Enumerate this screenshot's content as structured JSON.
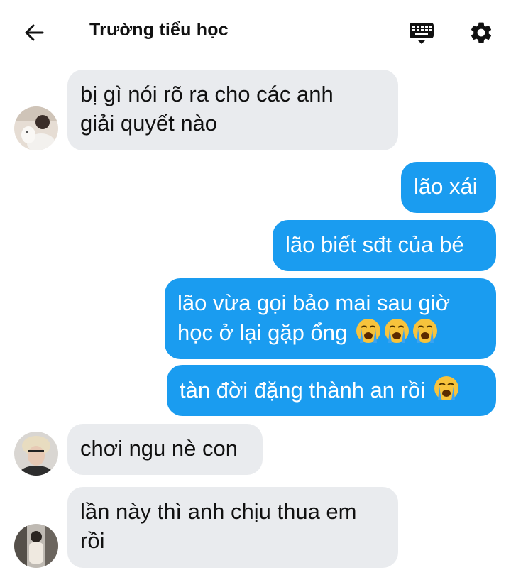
{
  "header": {
    "title": "Trường tiểu học",
    "back_icon": "arrow-left-icon",
    "keyboard_icon": "keyboard-icon",
    "settings_icon": "gear-icon"
  },
  "messages": [
    {
      "side": "in",
      "line1": "bị gì nói rõ ra cho các anh",
      "line2": "giải quyết nào",
      "avatar": "avatar-1"
    },
    {
      "side": "out",
      "text": "lão xái"
    },
    {
      "side": "out",
      "text": "lão biết sđt của bé"
    },
    {
      "side": "out",
      "line1": "lão vừa gọi bảo mai sau giờ",
      "line2": "học ở lại gặp ổng",
      "emoji": "loudly-crying-face x3"
    },
    {
      "side": "out",
      "text": "tàn đời đặng thành an rồi",
      "emoji": "loudly-crying-face"
    },
    {
      "side": "in",
      "text": "chơi ngu nè con",
      "avatar": "avatar-2"
    },
    {
      "side": "in",
      "line1": "lần này thì anh chịu thua em",
      "line2": "rồi",
      "avatar": "avatar-3"
    }
  ],
  "colors": {
    "outgoing": "#1a9cf0",
    "incoming": "#e9ebee",
    "emoji_face": "#f7c33c",
    "tears": "#3aa3f2"
  }
}
